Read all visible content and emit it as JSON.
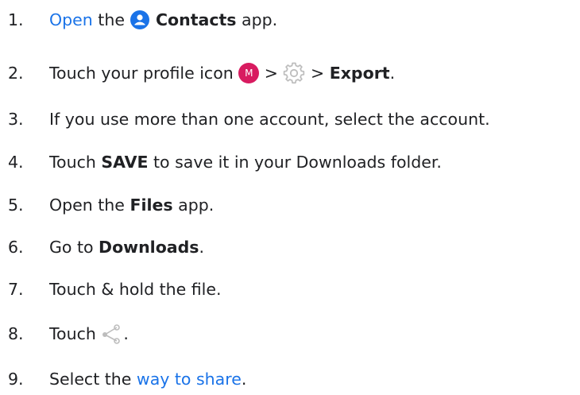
{
  "steps": [
    {
      "num": "1.",
      "link": "Open",
      "t1": " the ",
      "bold": "Contacts",
      "t2": " app.",
      "icon": "contacts-app-icon"
    },
    {
      "num": "2.",
      "t1": "Touch your profile icon ",
      "avatar_letter": "M",
      "sep1": " > ",
      "icon": "gear-icon",
      "sep2": " > ",
      "bold": "Export",
      "t2": "."
    },
    {
      "num": "3.",
      "text": "If you use more than one account, select the account."
    },
    {
      "num": "4.",
      "t1": "Touch ",
      "bold": "SAVE",
      "t2": " to save it in your Downloads folder."
    },
    {
      "num": "5.",
      "t1": "Open the ",
      "bold": "Files",
      "t2": " app."
    },
    {
      "num": "6.",
      "t1": "Go to ",
      "bold": "Downloads",
      "t2": "."
    },
    {
      "num": "7.",
      "text": "Touch & hold the file."
    },
    {
      "num": "8.",
      "t1": "Touch ",
      "icon": "share-icon",
      "t2": "."
    },
    {
      "num": "9.",
      "t1": "Select the ",
      "link": "way to share",
      "t2": "."
    }
  ],
  "colors": {
    "link": "#1a73e8",
    "contacts_icon": "#1a73e8",
    "avatar": "#d81b60",
    "gear": "#bdbdbd",
    "share": "#bdbdbd",
    "text": "#202124"
  }
}
